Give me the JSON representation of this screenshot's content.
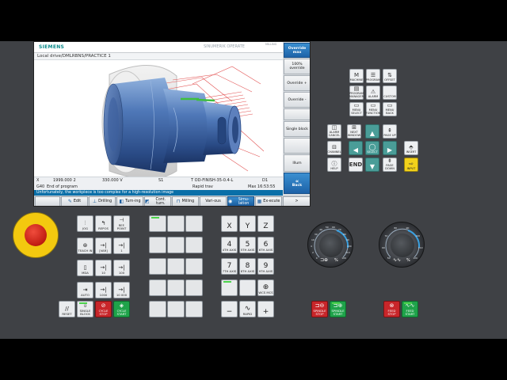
{
  "hmi": {
    "brand": "SIEMENS",
    "product": "SINUMERIK OPERATE",
    "header_small": "MILLING",
    "path": "Local drive/DMLRBNS/PRACTICE 1",
    "status": {
      "axis_label": "X",
      "axis_value": "1999.000 2",
      "feed_value": "330.000 V",
      "spindle": "S1",
      "tool": "T OD-FINISH-35-0.4-L",
      "d": "D1",
      "line_num": "G40",
      "program_state": "End of program",
      "motion": "Rapid trav",
      "max": "Max 16:53:55"
    },
    "message": "Unfortunately, the workpiece is too complex for a high-resolution image",
    "vertical_softkeys": [
      {
        "label": "Override max",
        "active": true
      },
      {
        "label": "100% override",
        "active": false
      },
      {
        "label": "Override +",
        "active": false
      },
      {
        "label": "Override -",
        "active": false
      },
      {
        "label": "",
        "active": false
      },
      {
        "label": "Single block",
        "active": false
      },
      {
        "label": "",
        "active": false
      },
      {
        "label": "Illum",
        "active": false
      },
      {
        "label": "Back",
        "active": true
      }
    ],
    "horizontal_softkeys": [
      {
        "label": "",
        "active": false
      },
      {
        "label": "Edit",
        "active": false
      },
      {
        "label": "Drilling",
        "active": false
      },
      {
        "label": "Turn-ing",
        "active": false
      },
      {
        "label": "Cont. turn.",
        "active": false
      },
      {
        "label": "Milling",
        "active": false
      },
      {
        "label": "Vari-ous",
        "active": false
      },
      {
        "label": "Simu-lation",
        "active": true
      },
      {
        "label": "Ex-ecute",
        "active": false
      },
      {
        "label": ">",
        "active": false
      }
    ]
  },
  "keypad": {
    "top_keys": [
      {
        "icon": "M",
        "label": "MACHINE"
      },
      {
        "icon": "☰",
        "label": "PROGRAM"
      },
      {
        "icon": "⇅",
        "label": "OFFSET"
      },
      {
        "icon": "▤",
        "label": "PROGRAM MANAGER"
      },
      {
        "icon": "⚠",
        "label": "ALARM"
      },
      {
        "icon": "",
        "label": "CUSTOM"
      },
      {
        "icon": "▭",
        "label": "MENU SELECT"
      },
      {
        "icon": "▭",
        "label": "MENU FUNCTION"
      },
      {
        "icon": "▭",
        "label": "MENU BACK"
      }
    ],
    "nav_keys": [
      {
        "icon": "◫",
        "label": "ALARM CANCEL",
        "style": "normal"
      },
      {
        "icon": "⊞",
        "label": "NEXT WINDOW",
        "style": "normal"
      },
      {
        "icon": "▲",
        "label": "",
        "style": "teal"
      },
      {
        "icon": "⇞",
        "label": "PAGE UP",
        "style": "normal"
      },
      {
        "icon": "⊟",
        "label": "CHANNEL",
        "style": "normal"
      },
      {
        "icon": "◀",
        "label": "",
        "style": "teal"
      },
      {
        "icon": "◯",
        "label": "SELECT",
        "style": "teal"
      },
      {
        "icon": "▶",
        "label": "",
        "style": "teal"
      },
      {
        "icon": "⬘",
        "label": "INSERT",
        "style": "normal"
      },
      {
        "icon": "ⓘ",
        "label": "HELP",
        "style": "normal"
      },
      {
        "icon": "END",
        "label": "",
        "style": "text"
      },
      {
        "icon": "▼",
        "label": "",
        "style": "teal"
      },
      {
        "icon": "⇟",
        "label": "PAGE DOWN",
        "style": "normal"
      },
      {
        "icon": "⇨",
        "label": "INPUT",
        "style": "yellow"
      }
    ]
  },
  "mcp": {
    "mode_keys": [
      {
        "icon": "⫶",
        "label": "JOG"
      },
      {
        "icon": "↰",
        "label": "REPOS"
      },
      {
        "icon": "⊣",
        "label": "REF. POINT"
      },
      {
        "icon": "⊛",
        "label": "TEACH IN"
      },
      {
        "icon": "→|",
        "label": "[VAR]"
      },
      {
        "icon": "→|",
        "label": "1"
      },
      {
        "icon": "▯",
        "label": "MDA"
      },
      {
        "icon": "→|",
        "label": "10"
      },
      {
        "icon": "→|",
        "label": "100"
      },
      {
        "icon": "⇥",
        "label": "AUTO"
      },
      {
        "icon": "→|",
        "label": "1000"
      },
      {
        "icon": "→|",
        "label": "10 000"
      }
    ],
    "bottom_keys": [
      {
        "icon": "//",
        "label": "RESET",
        "style": "normal"
      },
      {
        "icon": "⇩",
        "label": "SINGLE BLOCK",
        "style": "normal"
      },
      {
        "icon": "⊘",
        "label": "CYCLE STOP",
        "style": "red"
      },
      {
        "icon": "◈",
        "label": "CYCLE START",
        "style": "green"
      }
    ],
    "axis_keys": [
      {
        "icon": "X",
        "label": ""
      },
      {
        "icon": "Y",
        "label": ""
      },
      {
        "icon": "Z",
        "label": ""
      },
      {
        "icon": "4",
        "label": "4TH AXIS"
      },
      {
        "icon": "5",
        "label": "5TH AXIS"
      },
      {
        "icon": "6",
        "label": "6TH AXIS"
      },
      {
        "icon": "7",
        "label": "7TH AXIS"
      },
      {
        "icon": "8",
        "label": "8TH AXIS"
      },
      {
        "icon": "9",
        "label": "9TH AXIS"
      },
      {
        "icon": "",
        "label": ""
      },
      {
        "icon": "",
        "label": ""
      },
      {
        "icon": "⊕",
        "label": "WCS MCS"
      },
      {
        "icon": "−",
        "label": ""
      },
      {
        "icon": "∿",
        "label": "RAPID"
      },
      {
        "icon": "+",
        "label": ""
      }
    ],
    "spindle_keys": [
      {
        "icon": "⊐⊖",
        "label": "SPINDLE STOP",
        "style": "red"
      },
      {
        "icon": "⊐⊕",
        "label": "SPINDLE START",
        "style": "green"
      }
    ],
    "feed_keys": [
      {
        "icon": "⊗",
        "label": "FEED STOP",
        "style": "red"
      },
      {
        "icon": "∿∿",
        "label": "FEED START",
        "style": "green"
      }
    ],
    "dial_left_label": "%",
    "dial_right_label": "%",
    "dial_left_ticks": [
      "0",
      "2",
      "4",
      "10",
      "30",
      "40",
      "50",
      "60",
      "70",
      "80",
      "90",
      "100",
      "110",
      "120"
    ],
    "dial_right_ticks": [
      "50",
      "60",
      "70",
      "80",
      "90",
      "100",
      "110",
      "120"
    ]
  }
}
